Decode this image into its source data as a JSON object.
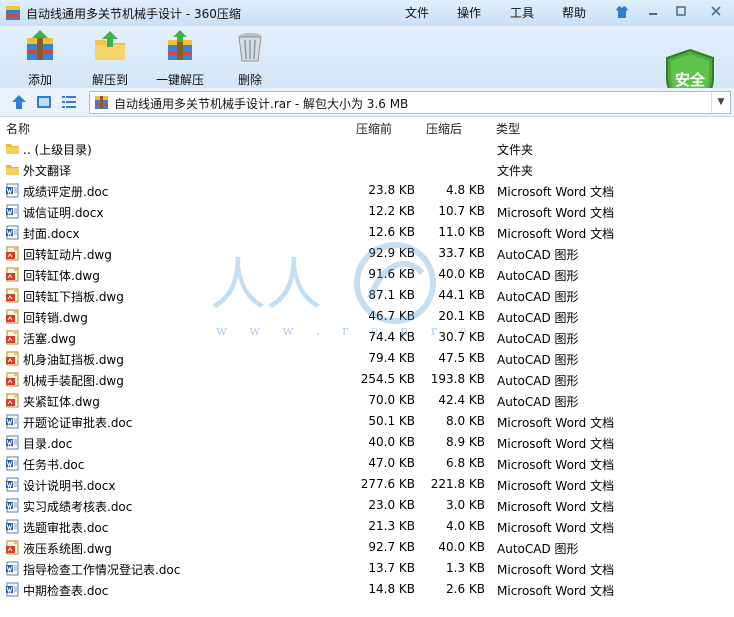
{
  "window": {
    "title": "自动线通用多关节机械手设计 - 360压缩",
    "menus": [
      "文件",
      "操作",
      "工具",
      "帮助"
    ]
  },
  "toolbar": {
    "add_label": "添加",
    "extract_label": "解压到",
    "one_click_label": "一键解压",
    "delete_label": "删除",
    "security_label": "安全"
  },
  "address": {
    "path": "自动线通用多关节机械手设计.rar - 解包大小为 3.6 MB"
  },
  "columns": {
    "name": "名称",
    "size": "压缩前",
    "packed": "压缩后",
    "type": "类型"
  },
  "watermark": {
    "chars": "人人",
    "url": "w w w . r e n r e"
  },
  "files": [
    {
      "name": ".. (上级目录)",
      "size": "",
      "packed": "",
      "type": "文件夹",
      "kind": "folder"
    },
    {
      "name": "外文翻译",
      "size": "",
      "packed": "",
      "type": "文件夹",
      "kind": "folder"
    },
    {
      "name": "成绩评定册.doc",
      "size": "23.8 KB",
      "packed": "4.8 KB",
      "type": "Microsoft Word 文档",
      "kind": "doc"
    },
    {
      "name": "诚信证明.docx",
      "size": "12.2 KB",
      "packed": "10.7 KB",
      "type": "Microsoft Word 文档",
      "kind": "doc"
    },
    {
      "name": "封面.docx",
      "size": "12.6 KB",
      "packed": "11.0 KB",
      "type": "Microsoft Word 文档",
      "kind": "doc"
    },
    {
      "name": "回转缸动片.dwg",
      "size": "92.9 KB",
      "packed": "33.7 KB",
      "type": "AutoCAD 图形",
      "kind": "dwg"
    },
    {
      "name": "回转缸体.dwg",
      "size": "91.6 KB",
      "packed": "40.0 KB",
      "type": "AutoCAD 图形",
      "kind": "dwg"
    },
    {
      "name": "回转缸下挡板.dwg",
      "size": "87.1 KB",
      "packed": "44.1 KB",
      "type": "AutoCAD 图形",
      "kind": "dwg"
    },
    {
      "name": "回转销.dwg",
      "size": "46.7 KB",
      "packed": "20.1 KB",
      "type": "AutoCAD 图形",
      "kind": "dwg"
    },
    {
      "name": "活塞.dwg",
      "size": "74.4 KB",
      "packed": "30.7 KB",
      "type": "AutoCAD 图形",
      "kind": "dwg"
    },
    {
      "name": "机身油缸挡板.dwg",
      "size": "79.4 KB",
      "packed": "47.5 KB",
      "type": "AutoCAD 图形",
      "kind": "dwg"
    },
    {
      "name": "机械手装配图.dwg",
      "size": "254.5 KB",
      "packed": "193.8 KB",
      "type": "AutoCAD 图形",
      "kind": "dwg"
    },
    {
      "name": "夹紧缸体.dwg",
      "size": "70.0 KB",
      "packed": "42.4 KB",
      "type": "AutoCAD 图形",
      "kind": "dwg"
    },
    {
      "name": "开题论证审批表.doc",
      "size": "50.1 KB",
      "packed": "8.0 KB",
      "type": "Microsoft Word 文档",
      "kind": "doc"
    },
    {
      "name": "目录.doc",
      "size": "40.0 KB",
      "packed": "8.9 KB",
      "type": "Microsoft Word 文档",
      "kind": "doc"
    },
    {
      "name": "任务书.doc",
      "size": "47.0 KB",
      "packed": "6.8 KB",
      "type": "Microsoft Word 文档",
      "kind": "doc"
    },
    {
      "name": "设计说明书.docx",
      "size": "277.6 KB",
      "packed": "221.8 KB",
      "type": "Microsoft Word 文档",
      "kind": "doc"
    },
    {
      "name": "实习成绩考核表.doc",
      "size": "23.0 KB",
      "packed": "3.0 KB",
      "type": "Microsoft Word 文档",
      "kind": "doc"
    },
    {
      "name": "选题审批表.doc",
      "size": "21.3 KB",
      "packed": "4.0 KB",
      "type": "Microsoft Word 文档",
      "kind": "doc"
    },
    {
      "name": "液压系统图.dwg",
      "size": "92.7 KB",
      "packed": "40.0 KB",
      "type": "AutoCAD 图形",
      "kind": "dwg"
    },
    {
      "name": "指导检查工作情况登记表.doc",
      "size": "13.7 KB",
      "packed": "1.3 KB",
      "type": "Microsoft Word 文档",
      "kind": "doc"
    },
    {
      "name": "中期检查表.doc",
      "size": "14.8 KB",
      "packed": "2.6 KB",
      "type": "Microsoft Word 文档",
      "kind": "doc"
    }
  ]
}
